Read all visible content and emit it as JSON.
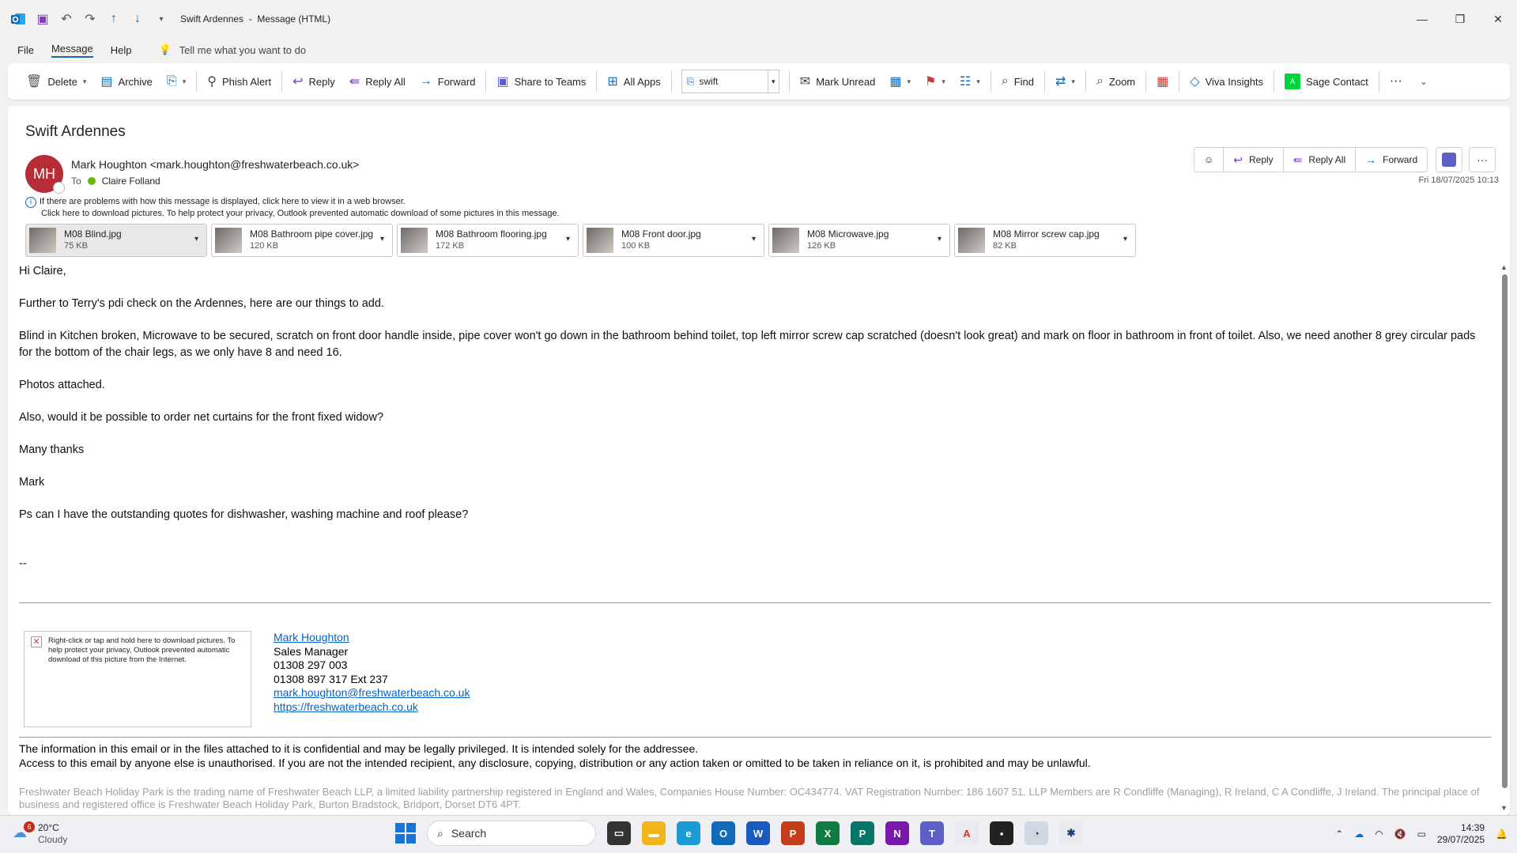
{
  "window": {
    "title": "Swift Ardennes",
    "mode": "Message (HTML)",
    "separator": "-"
  },
  "menu": {
    "file": "File",
    "message": "Message",
    "help": "Help",
    "tell_me": "Tell me what you want to do"
  },
  "ribbon": {
    "delete": "Delete",
    "archive": "Archive",
    "phish_alert": "Phish Alert",
    "reply": "Reply",
    "reply_all": "Reply All",
    "forward": "Forward",
    "share_to_teams": "Share to Teams",
    "all_apps": "All Apps",
    "move_value": "swift",
    "mark_unread": "Mark Unread",
    "find": "Find",
    "zoom": "Zoom",
    "viva_insights": "Viva Insights",
    "sage_contact": "Sage Contact"
  },
  "message": {
    "subject": "Swift Ardennes",
    "avatar_initials": "MH",
    "sender": "Mark Houghton <mark.houghton@freshwaterbeach.co.uk>",
    "to_label": "To",
    "recipient": "Claire Folland",
    "date": "Fri 18/07/2025 10:13",
    "info_line1": "If there are problems with how this message is displayed, click here to view it in a web browser.",
    "info_line2": "Click here to download pictures. To help protect your privacy, Outlook prevented automatic download of some pictures in this message.",
    "actions": {
      "reply": "Reply",
      "reply_all": "Reply All",
      "forward": "Forward"
    },
    "attachments": [
      {
        "name": "M08 Blind.jpg",
        "size": "75 KB"
      },
      {
        "name": "M08 Bathroom pipe cover.jpg",
        "size": "120 KB"
      },
      {
        "name": "M08 Bathroom flooring.jpg",
        "size": "172 KB"
      },
      {
        "name": "M08 Front door.jpg",
        "size": "100 KB"
      },
      {
        "name": "M08 Microwave.jpg",
        "size": "126 KB"
      },
      {
        "name": "M08 Mirror screw cap.jpg",
        "size": "82 KB"
      }
    ],
    "body": [
      "Hi Claire,",
      "Further to Terry's pdi check on the Ardennes, here are our things to add.",
      "Blind in Kitchen broken, Microwave to be secured, scratch on front door handle inside, pipe cover won't go down in the bathroom behind toilet, top left mirror screw cap scratched (doesn't look great) and mark on floor in bathroom in front of toilet. Also, we need another 8 grey circular pads for the bottom of the chair legs, as we only have 8 and need 16.",
      "Photos attached.",
      "Also, would it be possible to order net curtains for the front fixed widow?",
      "Many thanks",
      "Mark",
      "Ps can I have the outstanding quotes for dishwasher, washing machine and roof please?"
    ],
    "sig_dash": "--",
    "blocked_image_text": "Right-click or tap and hold here to download pictures. To help protect your privacy, Outlook prevented automatic download of this picture from the Internet.",
    "signature": {
      "name": "Mark Houghton",
      "role": "Sales Manager",
      "phone1": "01308 297 003",
      "phone2": "01308 897 317 Ext 237",
      "email": "mark.houghton@freshwaterbeach.co.uk",
      "website": "https://freshwaterbeach.co.uk"
    },
    "confidential_line1": "The information in this email or in the files attached to it is confidential and may be legally privileged. It is intended solely for the addressee.",
    "confidential_line2": "Access to this email by anyone else is unauthorised. If you are not the intended recipient, any disclosure, copying, distribution or any action taken or omitted to be taken in reliance on it, is prohibited and may be unlawful.",
    "legal": "Freshwater Beach Holiday Park is the trading name of Freshwater Beach LLP, a limited liability partnership registered in England and Wales, Companies House Number: OC434774. VAT Registration Number: 186 1607 51. LLP Members are R Condliffe (Managing), R Ireland, C A Condliffe, J Ireland. The principal place of business and registered office is Freshwater Beach Holiday Park, Burton Bradstock, Bridport, Dorset DT6 4PT."
  },
  "taskbar": {
    "weather_temp": "20°C",
    "weather_cond": "Cloudy",
    "weather_badge": "6",
    "search": "Search",
    "time": "14:39",
    "date": "29/07/2025"
  },
  "colors": {
    "accent": "#0f6cbd",
    "avatar": "#b52e36"
  }
}
